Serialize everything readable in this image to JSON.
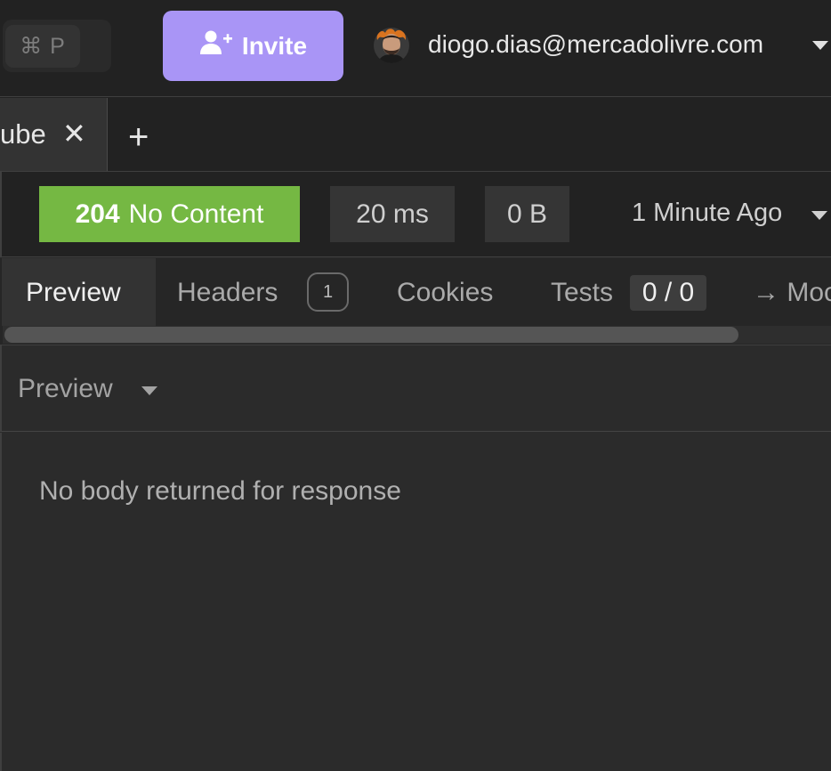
{
  "topbar": {
    "shortcut": "⌘ P",
    "invite_label": "Invite",
    "user_email": "diogo.dias@mercadolivre.com"
  },
  "tabs": {
    "active_label": "ube",
    "close_glyph": "✕",
    "add_glyph": "+"
  },
  "status": {
    "code": "204",
    "text": "No Content",
    "time": "20 ms",
    "size": "0 B",
    "history": "1 Minute Ago"
  },
  "response_tabs": {
    "preview": "Preview",
    "headers": "Headers",
    "headers_count": "1",
    "cookies": "Cookies",
    "tests": "Tests",
    "tests_count": "0 / 0",
    "more": "→ Moc"
  },
  "preview_mode": {
    "label": "Preview"
  },
  "body": {
    "message": "No body returned for response"
  },
  "colors": {
    "status_success": "#75b843",
    "invite_button": "#a995f6",
    "background": "#2b2b2b"
  },
  "icons": {
    "invite": "add-user-icon",
    "avatar": "user-avatar",
    "caret": "chevron-down-icon"
  }
}
